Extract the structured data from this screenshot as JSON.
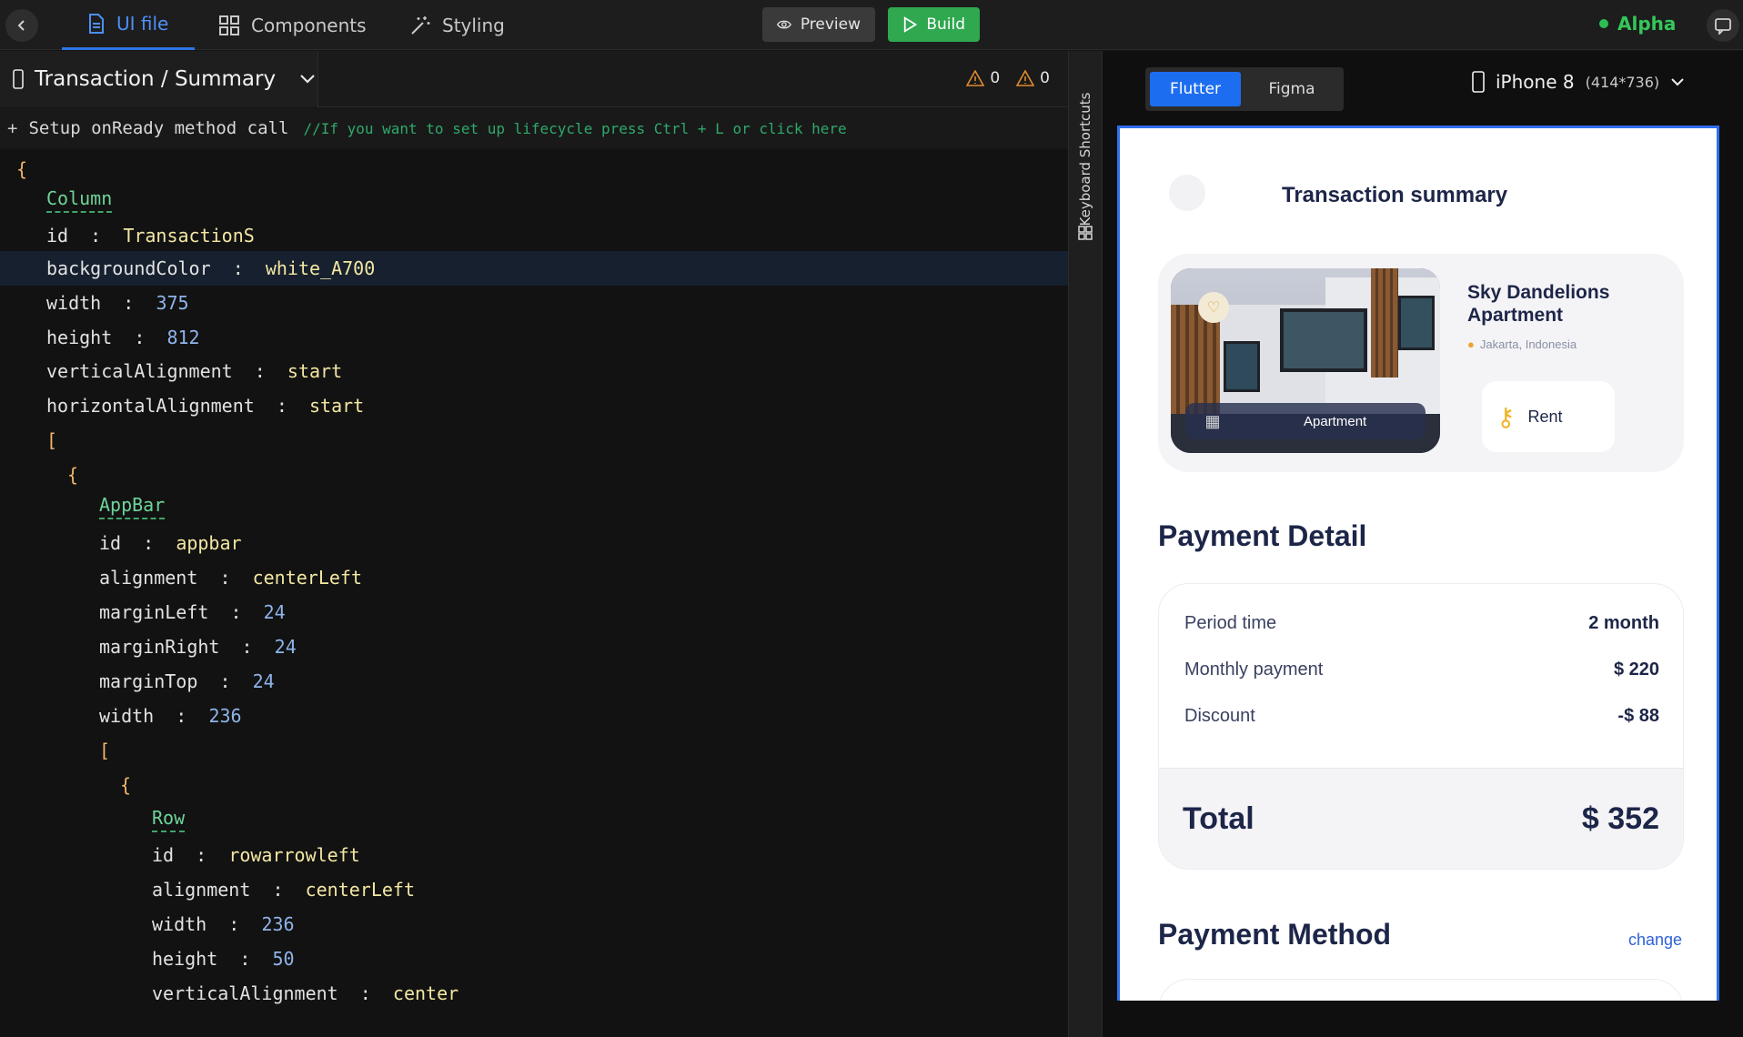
{
  "topbar": {
    "tabs": [
      {
        "label": "UI file",
        "icon": "file-icon",
        "active": true
      },
      {
        "label": "Components",
        "icon": "grid-icon",
        "active": false
      },
      {
        "label": "Styling",
        "icon": "magic-wand-icon",
        "active": false
      }
    ],
    "preview_label": "Preview",
    "build_label": "Build",
    "env_label": "Alpha",
    "colors": {
      "active_tab": "#4d8ff7",
      "build": "#2fa84f",
      "env": "#34c759"
    }
  },
  "editor": {
    "file_title": "Transaction / Summary",
    "warnings": [
      "0",
      "0"
    ],
    "setup": {
      "label": "Setup onReady method call",
      "hint": "//If you want to set up lifecycle press Ctrl + L or click here"
    },
    "lines": [
      {
        "indent": 0,
        "type": "brace",
        "text": "{"
      },
      {
        "indent": 1,
        "type": "widget",
        "text": "Column"
      },
      {
        "indent": 1,
        "type": "prop",
        "key": "id",
        "value": "TransactionS",
        "vtype": "s"
      },
      {
        "indent": 1,
        "type": "prop",
        "key": "backgroundColor",
        "value": "white_A700",
        "vtype": "s",
        "highlight": true
      },
      {
        "indent": 1,
        "type": "prop",
        "key": "width",
        "value": "375",
        "vtype": "n"
      },
      {
        "indent": 1,
        "type": "prop",
        "key": "height",
        "value": "812",
        "vtype": "n"
      },
      {
        "indent": 1,
        "type": "prop",
        "key": "verticalAlignment",
        "value": "start",
        "vtype": "s"
      },
      {
        "indent": 1,
        "type": "prop",
        "key": "horizontalAlignment",
        "value": "start",
        "vtype": "s"
      },
      {
        "indent": 1,
        "type": "brace",
        "text": "["
      },
      {
        "indent": 2,
        "type": "brace",
        "text": "{"
      },
      {
        "indent": 3,
        "type": "widget",
        "text": "AppBar"
      },
      {
        "indent": 3,
        "type": "prop",
        "key": "id",
        "value": "appbar",
        "vtype": "s"
      },
      {
        "indent": 3,
        "type": "prop",
        "key": "alignment",
        "value": "centerLeft",
        "vtype": "s"
      },
      {
        "indent": 3,
        "type": "prop",
        "key": "marginLeft",
        "value": "24",
        "vtype": "n"
      },
      {
        "indent": 3,
        "type": "prop",
        "key": "marginRight",
        "value": "24",
        "vtype": "n"
      },
      {
        "indent": 3,
        "type": "prop",
        "key": "marginTop",
        "value": "24",
        "vtype": "n"
      },
      {
        "indent": 3,
        "type": "prop",
        "key": "width",
        "value": "236",
        "vtype": "n"
      },
      {
        "indent": 3,
        "type": "brace",
        "text": "["
      },
      {
        "indent": 4,
        "type": "brace",
        "text": "{"
      },
      {
        "indent": 5,
        "type": "widget",
        "text": "Row"
      },
      {
        "indent": 5,
        "type": "prop",
        "key": "id",
        "value": "rowarrowleft",
        "vtype": "s"
      },
      {
        "indent": 5,
        "type": "prop",
        "key": "alignment",
        "value": "centerLeft",
        "vtype": "s"
      },
      {
        "indent": 5,
        "type": "prop",
        "key": "width",
        "value": "236",
        "vtype": "n"
      },
      {
        "indent": 5,
        "type": "prop",
        "key": "height",
        "value": "50",
        "vtype": "n"
      },
      {
        "indent": 5,
        "type": "prop",
        "key": "verticalAlignment",
        "value": "center",
        "vtype": "s"
      }
    ]
  },
  "rail": {
    "label": "Keyboard Shortcuts"
  },
  "preview": {
    "segments": [
      "Flutter",
      "Figma"
    ],
    "device_name": "iPhone 8",
    "device_dims": "(414*736)",
    "app": {
      "title": "Transaction summary",
      "property": {
        "name": "Sky Dandelions Apartment",
        "location": "Jakarta, Indonesia",
        "badge": "Apartment",
        "rent_label": "Rent"
      },
      "payment_detail_heading": "Payment Detail",
      "rows": [
        {
          "label": "Period time",
          "value": "2 month"
        },
        {
          "label": "Monthly payment",
          "value": "$ 220"
        },
        {
          "label": "Discount",
          "value": "-$ 88"
        }
      ],
      "total_label": "Total",
      "total_value": "$ 352",
      "payment_method_heading": "Payment Method",
      "change_label": "change"
    }
  }
}
